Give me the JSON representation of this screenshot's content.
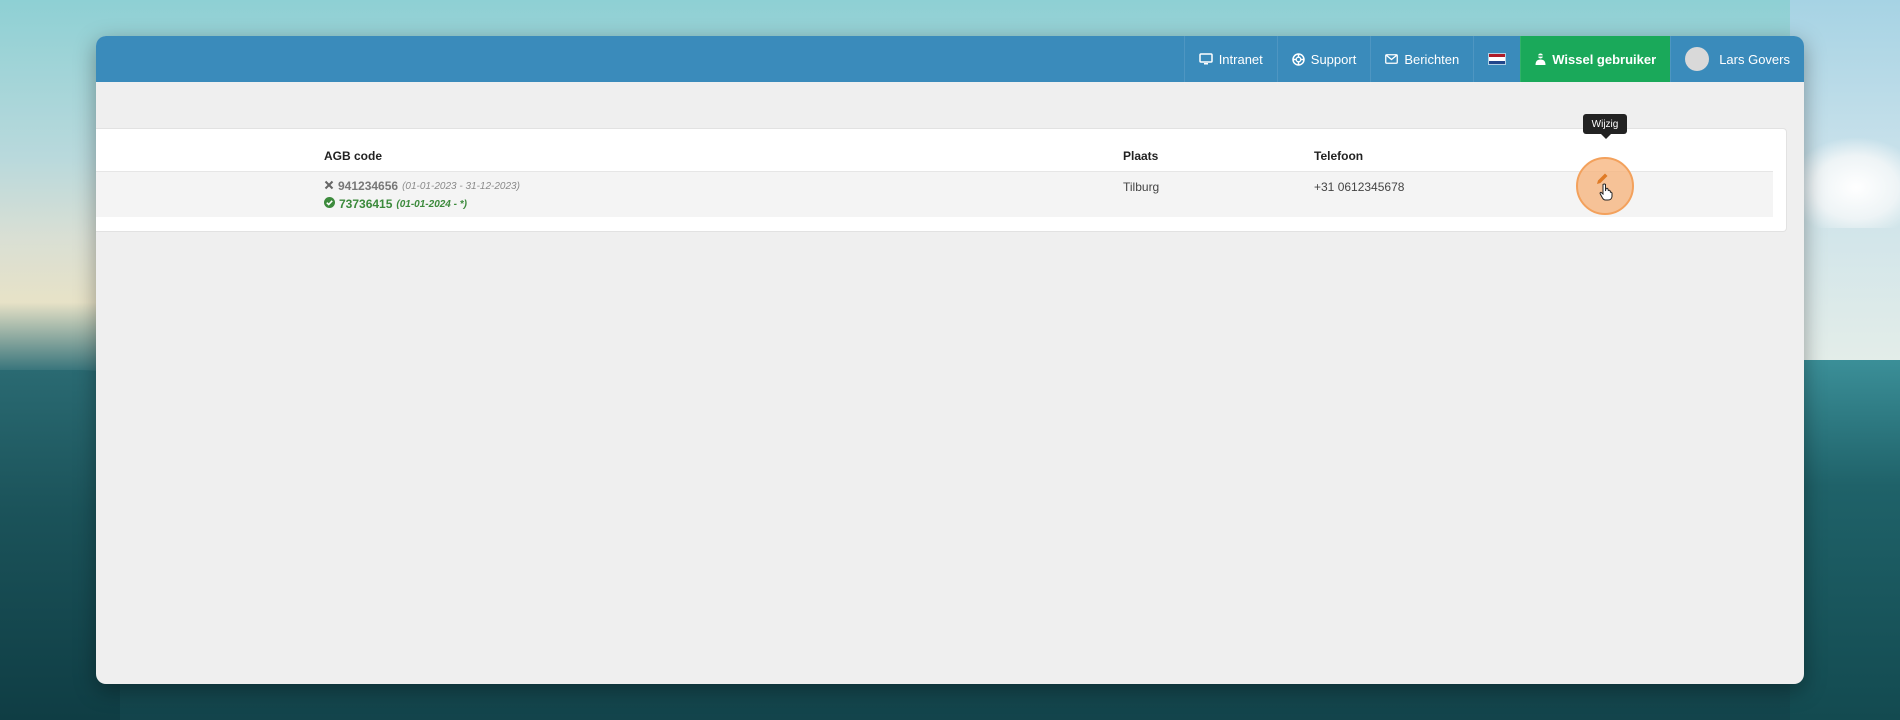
{
  "topbar": {
    "intranet_label": "Intranet",
    "support_label": "Support",
    "messages_label": "Berichten",
    "language_flag": "nl-flag-icon",
    "switch_user_label": "Wissel gebruiker",
    "user_name": "Lars Govers"
  },
  "table": {
    "columns": {
      "agb": "AGB code",
      "place": "Plaats",
      "phone": "Telefoon"
    },
    "rows": [
      {
        "agb_codes": [
          {
            "status": "inactive",
            "code": "941234656",
            "period": "(01-01-2023 - 31-12-2023)"
          },
          {
            "status": "active",
            "code": "73736415",
            "period": "(01-01-2024 - *)"
          }
        ],
        "place": "Tilburg",
        "phone": "+31 0612345678"
      }
    ]
  },
  "tooltip": {
    "edit": "Wijzig"
  },
  "colors": {
    "topbar": "#3a8bbb",
    "switch_user": "#1aa95a",
    "active_code": "#3c8a3c",
    "highlight": "#f3a15c"
  }
}
